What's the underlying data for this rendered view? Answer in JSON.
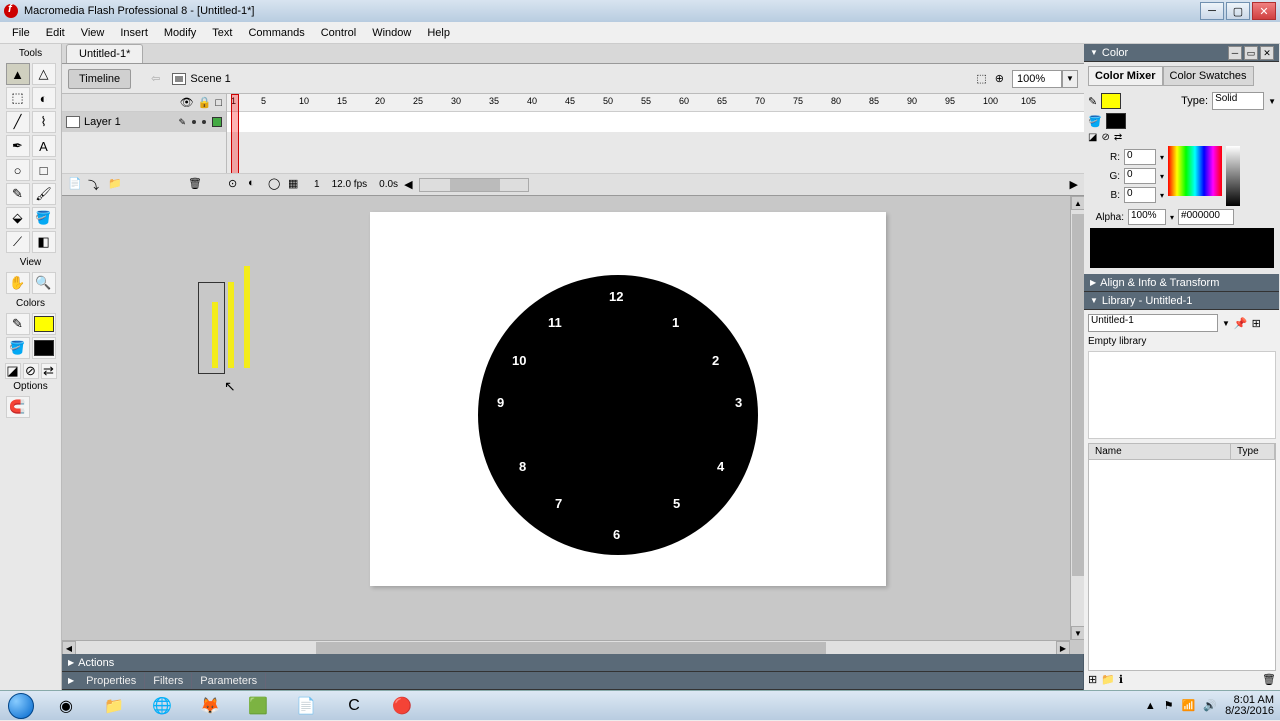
{
  "window": {
    "title": "Macromedia Flash Professional 8 - [Untitled-1*]"
  },
  "menu": {
    "items": [
      "File",
      "Edit",
      "View",
      "Insert",
      "Modify",
      "Text",
      "Commands",
      "Control",
      "Window",
      "Help"
    ]
  },
  "document": {
    "tab": "Untitled-1*",
    "timeline_btn": "Timeline",
    "scene": "Scene 1",
    "zoom": "100%"
  },
  "toolbox": {
    "header": "Tools",
    "view": "View",
    "colors": "Colors",
    "options": "Options"
  },
  "timeline": {
    "layer": "Layer 1",
    "ruler_marks": [
      "1",
      "5",
      "10",
      "15",
      "20",
      "25",
      "30",
      "35",
      "40",
      "45",
      "50",
      "55",
      "60",
      "65",
      "70",
      "75",
      "80",
      "85",
      "90",
      "95",
      "100",
      "105"
    ],
    "frame": "1",
    "fps": "12.0 fps",
    "time": "0.0s"
  },
  "clock": {
    "numbers": [
      "12",
      "1",
      "2",
      "3",
      "4",
      "5",
      "6",
      "7",
      "8",
      "9",
      "10",
      "11"
    ]
  },
  "panels": {
    "color": "Color",
    "color_mixer": "Color Mixer",
    "color_swatches": "Color Swatches",
    "type_label": "Type:",
    "type_value": "Solid",
    "r": "R:",
    "r_val": "0",
    "g": "G:",
    "g_val": "0",
    "b": "B:",
    "b_val": "0",
    "alpha": "Alpha:",
    "alpha_val": "100%",
    "hex": "#000000",
    "align": "Align & Info & Transform",
    "library": "Library - Untitled-1",
    "lib_doc": "Untitled-1",
    "lib_status": "Empty library",
    "lib_col_name": "Name",
    "lib_col_type": "Type"
  },
  "bottom": {
    "actions": "Actions",
    "properties": "Properties",
    "filters": "Filters",
    "parameters": "Parameters"
  },
  "tray": {
    "time": "8:01 AM",
    "date": "8/23/2016"
  }
}
